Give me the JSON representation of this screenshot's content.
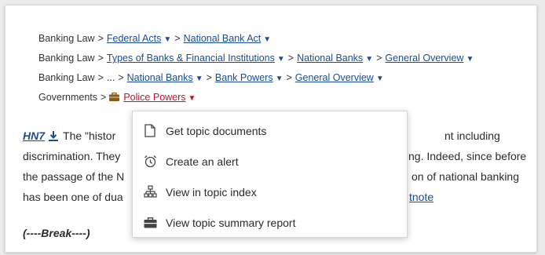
{
  "breadcrumbs": {
    "row1": {
      "root": "Banking Law",
      "sep": ">",
      "items": [
        "Federal Acts",
        "National Bank Act"
      ]
    },
    "row2": {
      "root": "Banking Law",
      "sep": ">",
      "items": [
        "Types of Banks & Financial Institutions",
        "National Banks",
        "General Overview"
      ]
    },
    "row3": {
      "root": "Banking Law",
      "sep": ">",
      "ellipsis": "...",
      "items": [
        "National Banks",
        "Bank Powers",
        "General Overview"
      ]
    },
    "row4": {
      "root": "Governments",
      "sep": ">",
      "items": [
        "Police Powers"
      ]
    }
  },
  "paragraph": {
    "headnote_label": "HN7",
    "line1": "The \"histor",
    "line1_right": "nt including",
    "line2": "discrimination. They",
    "line2_right": "ng. Indeed, since before",
    "line3": "the passage of the N",
    "line3_right": "on of national banking",
    "line4": "has been one of dua",
    "line4_link": "tnote"
  },
  "break_text": "(----Break----)",
  "context_menu": {
    "items": [
      {
        "label": "Get topic documents",
        "icon": "document-icon"
      },
      {
        "label": "Create an alert",
        "icon": "alarm-clock-icon"
      },
      {
        "label": "View in topic index",
        "icon": "hierarchy-icon"
      },
      {
        "label": "View topic summary report",
        "icon": "briefcase-icon"
      }
    ]
  },
  "colors": {
    "link": "#1a4d98",
    "active_link": "#c8102e",
    "brief_icon": "#8a5a1e"
  }
}
